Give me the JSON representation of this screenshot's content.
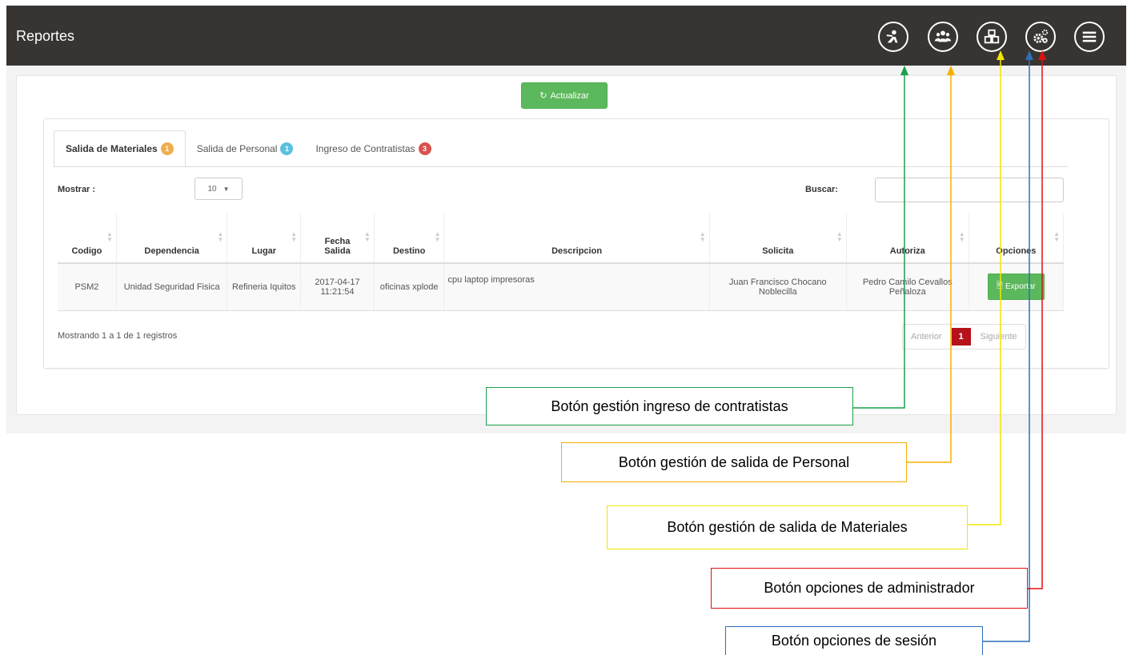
{
  "header": {
    "title": "Reportes",
    "buttons": [
      {
        "name": "contractor-entry-button",
        "icon": "security-guard-icon"
      },
      {
        "name": "personnel-exit-button",
        "icon": "users-group-icon"
      },
      {
        "name": "materials-exit-button",
        "icon": "boxes-icon"
      },
      {
        "name": "admin-options-button",
        "icon": "gears-icon"
      },
      {
        "name": "session-menu-button",
        "icon": "hamburger-menu-icon"
      }
    ]
  },
  "toolbar": {
    "refresh_label": "Actualizar"
  },
  "tabs": [
    {
      "label": "Salida de Materiales",
      "badge": "1",
      "badge_color": "#f0ad4e",
      "active": true
    },
    {
      "label": "Salida de Personal",
      "badge": "1",
      "badge_color": "#5bc0de",
      "active": false
    },
    {
      "label": "Ingreso de Contratistas",
      "badge": "3",
      "badge_color": "#d9534f",
      "active": false
    }
  ],
  "controls": {
    "show_label": "Mostrar :",
    "page_size": "10",
    "search_label": "Buscar:",
    "search_value": ""
  },
  "table": {
    "columns": [
      "Codigo",
      "Dependencia",
      "Lugar",
      "Fecha Salida",
      "Destino",
      "Descripcion",
      "Solicita",
      "Autoriza",
      "Opciones"
    ],
    "rows": [
      {
        "codigo": "PSM2",
        "dependencia": "Unidad Seguridad Fisica",
        "lugar": "Refineria Iquitos",
        "fecha": "2017-04-17 11:21:54",
        "destino": "oficinas xplode",
        "descripcion": "cpu laptop impresoras",
        "solicita": "Juan Francisco Chocano Noblecilla",
        "autoriza": "Pedro Camilo Cevallos Peñaloza",
        "opcion": "Exportar"
      }
    ]
  },
  "footer": {
    "info": "Mostrando 1 a 1 de 1 registros",
    "prev": "Anterior",
    "page": "1",
    "next": "Siguiente"
  },
  "annotations": [
    {
      "text": "Botón gestión  ingreso de contratistas",
      "color": "#1aa04a"
    },
    {
      "text": "Botón gestión de salida de Personal",
      "color": "#f5b000"
    },
    {
      "text": "Botón gestión de salida de Materiales",
      "color": "#f5e600"
    },
    {
      "text": "Botón opciones de administrador",
      "color": "#e01010"
    },
    {
      "text": "Botón opciones de sesión",
      "color": "#2e6fba"
    }
  ]
}
